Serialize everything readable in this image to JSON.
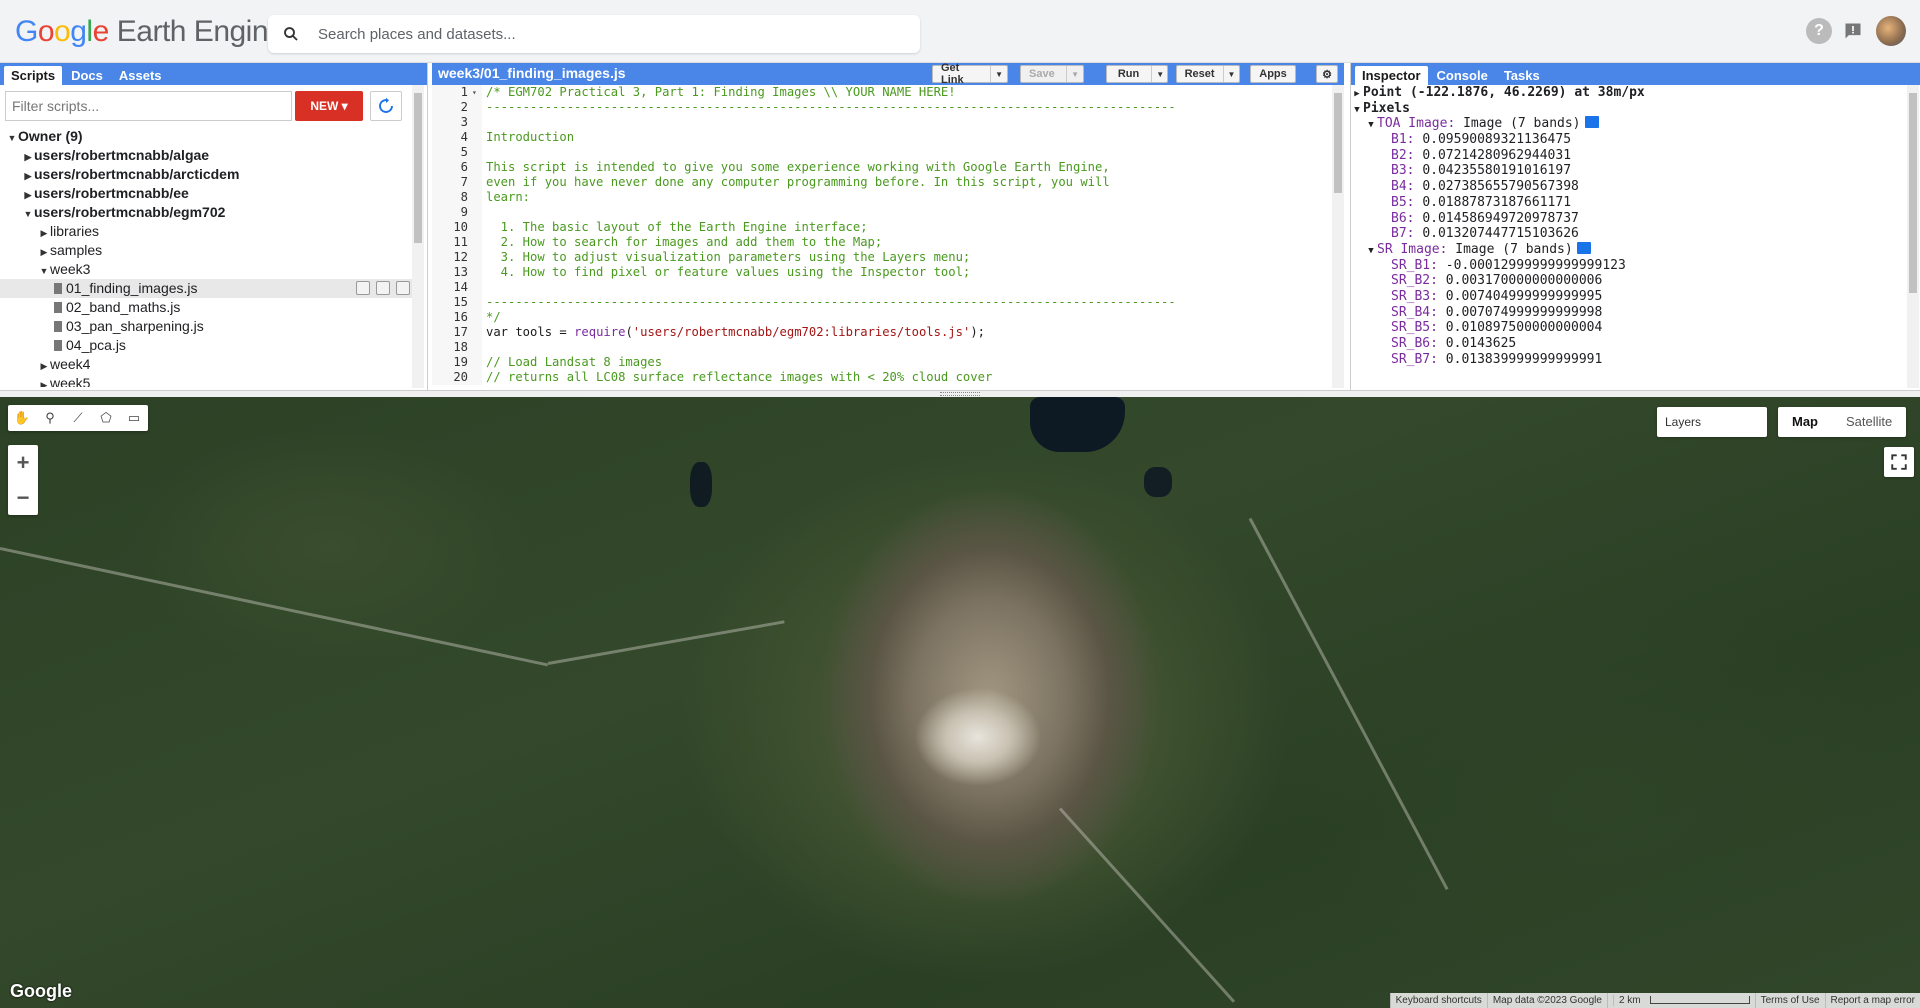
{
  "app": {
    "logo_google": [
      "G",
      "o",
      "o",
      "g",
      "l",
      "e"
    ],
    "logo_product": "Earth Engine",
    "search_placeholder": "Search places and datasets..."
  },
  "left_panel": {
    "tabs": [
      "Scripts",
      "Docs",
      "Assets"
    ],
    "filter_placeholder": "Filter scripts...",
    "new_button": "NEW",
    "tree": [
      {
        "label": "Owner (9)",
        "level": 0,
        "expanded": true,
        "bold": true,
        "type": "folder"
      },
      {
        "label": "users/robertmcnabb/algae",
        "level": 1,
        "expanded": false,
        "bold": true,
        "type": "folder"
      },
      {
        "label": "users/robertmcnabb/arcticdem",
        "level": 1,
        "expanded": false,
        "bold": true,
        "type": "folder"
      },
      {
        "label": "users/robertmcnabb/ee",
        "level": 1,
        "expanded": false,
        "bold": true,
        "type": "folder"
      },
      {
        "label": "users/robertmcnabb/egm702",
        "level": 1,
        "expanded": true,
        "bold": true,
        "type": "folder"
      },
      {
        "label": "libraries",
        "level": 2,
        "expanded": false,
        "bold": false,
        "type": "folder"
      },
      {
        "label": "samples",
        "level": 2,
        "expanded": false,
        "bold": false,
        "type": "folder"
      },
      {
        "label": "week3",
        "level": 2,
        "expanded": true,
        "bold": false,
        "type": "folder"
      },
      {
        "label": "01_finding_images.js",
        "level": 3,
        "bold": false,
        "type": "file",
        "selected": true
      },
      {
        "label": "02_band_maths.js",
        "level": 3,
        "bold": false,
        "type": "file"
      },
      {
        "label": "03_pan_sharpening.js",
        "level": 3,
        "bold": false,
        "type": "file"
      },
      {
        "label": "04_pca.js",
        "level": 3,
        "bold": false,
        "type": "file"
      },
      {
        "label": "week4",
        "level": 2,
        "expanded": false,
        "bold": false,
        "type": "folder"
      },
      {
        "label": "week5",
        "level": 2,
        "expanded": false,
        "bold": false,
        "type": "folder"
      }
    ]
  },
  "editor": {
    "filename": "week3/01_finding_images.js",
    "buttons": {
      "get_link": "Get Link",
      "save": "Save",
      "run": "Run",
      "reset": "Reset",
      "apps": "Apps"
    },
    "lines": [
      {
        "n": "1",
        "parts": [
          [
            "c",
            "/* EGM702 Practical 3, Part 1: Finding Images \\\\ YOUR NAME HERE!"
          ]
        ]
      },
      {
        "n": "2",
        "parts": [
          [
            "c",
            "----------------------------------------------------------------------------------------------"
          ]
        ]
      },
      {
        "n": "3",
        "parts": []
      },
      {
        "n": "4",
        "parts": [
          [
            "c",
            "Introduction"
          ]
        ]
      },
      {
        "n": "5",
        "parts": []
      },
      {
        "n": "6",
        "parts": [
          [
            "c",
            "This script is intended to give you some experience working with Google Earth Engine,"
          ]
        ]
      },
      {
        "n": "7",
        "parts": [
          [
            "c",
            "even if you have never done any computer programming before. In this script, you will"
          ]
        ]
      },
      {
        "n": "8",
        "parts": [
          [
            "c",
            "learn:"
          ]
        ]
      },
      {
        "n": "9",
        "parts": []
      },
      {
        "n": "10",
        "parts": [
          [
            "c",
            "  1. The basic layout of the Earth Engine interface;"
          ]
        ]
      },
      {
        "n": "11",
        "parts": [
          [
            "c",
            "  2. How to search for images and add them to the Map;"
          ]
        ]
      },
      {
        "n": "12",
        "parts": [
          [
            "c",
            "  3. How to adjust visualization parameters using the Layers menu;"
          ]
        ]
      },
      {
        "n": "13",
        "parts": [
          [
            "c",
            "  4. How to find pixel or feature values using the Inspector tool;"
          ]
        ]
      },
      {
        "n": "14",
        "parts": []
      },
      {
        "n": "15",
        "parts": [
          [
            "c",
            "----------------------------------------------------------------------------------------------"
          ]
        ]
      },
      {
        "n": "16",
        "parts": [
          [
            "c",
            "*/"
          ]
        ]
      },
      {
        "n": "17",
        "parts": [
          [
            "k",
            "var tools = "
          ],
          [
            "p",
            "require"
          ],
          [
            "k",
            "("
          ],
          [
            "s",
            "'users/robertmcnabb/egm702:libraries/tools.js'"
          ],
          [
            "k",
            ");"
          ]
        ]
      },
      {
        "n": "18",
        "parts": []
      },
      {
        "n": "19",
        "parts": [
          [
            "c",
            "// Load Landsat 8 images"
          ]
        ]
      },
      {
        "n": "20",
        "parts": [
          [
            "c",
            "// returns all LC08 surface reflectance images with < 20% cloud cover"
          ]
        ]
      }
    ]
  },
  "right_panel": {
    "tabs": [
      "Inspector",
      "Console",
      "Tasks"
    ],
    "point": "Point (-122.1876, 46.2269) at 38m/px",
    "pixels_label": "Pixels",
    "groups": [
      {
        "name": "TOA Image:",
        "desc": "Image (7 bands)",
        "bands": [
          [
            "B1:",
            "0.09590089321136475"
          ],
          [
            "B2:",
            "0.07214280962944031"
          ],
          [
            "B3:",
            "0.04235580191016197"
          ],
          [
            "B4:",
            "0.027385655790567398"
          ],
          [
            "B5:",
            "0.01887873187661171"
          ],
          [
            "B6:",
            "0.014586949720978737"
          ],
          [
            "B7:",
            "0.013207447715103626"
          ]
        ]
      },
      {
        "name": "SR Image:",
        "desc": "Image (7 bands)",
        "bands": [
          [
            "SR_B1:",
            "-0.00012999999999999123"
          ],
          [
            "SR_B2:",
            "0.003170000000000006"
          ],
          [
            "SR_B3:",
            "0.007404999999999995"
          ],
          [
            "SR_B4:",
            "0.007074999999999998"
          ],
          [
            "SR_B5:",
            "0.010897500000000004"
          ],
          [
            "SR_B6:",
            "0.0143625"
          ],
          [
            "SR_B7:",
            "0.013839999999999991"
          ]
        ]
      }
    ]
  },
  "map": {
    "layers_label": "Layers",
    "map_type": [
      "Map",
      "Satellite"
    ],
    "google_logo": "Google",
    "attribution": [
      "Keyboard shortcuts",
      "Map data ©2023 Google",
      "2 km",
      "Terms of Use",
      "Report a map error"
    ]
  },
  "colors": {
    "accent": "#4a86e8",
    "new_button": "#d93025",
    "comment": "#4a9a1f",
    "string": "#a31515",
    "property": "#7a2c9e"
  }
}
